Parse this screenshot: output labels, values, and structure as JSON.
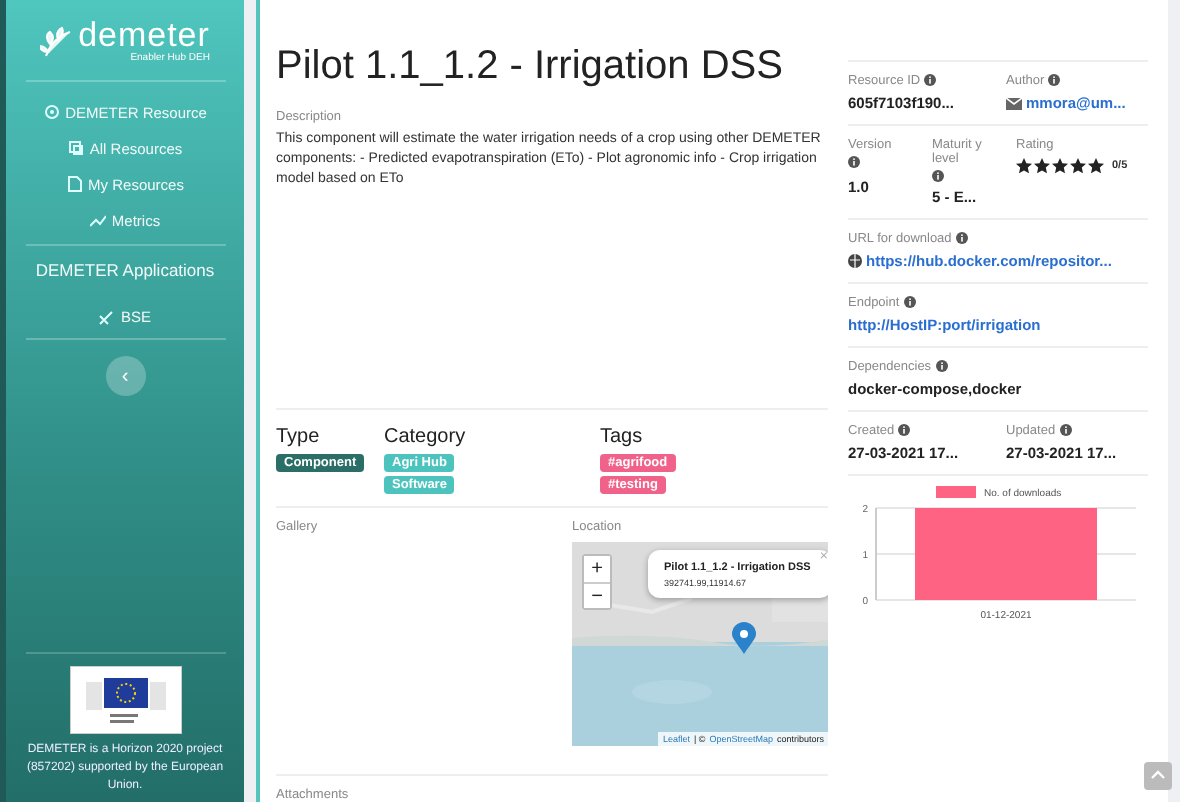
{
  "sidebar": {
    "logo": {
      "name": "demeter",
      "subtitle": "Enabler Hub DEH"
    },
    "items": [
      {
        "label": "DEMETER Resource",
        "kind": "header"
      },
      {
        "label": "All Resources",
        "kind": "link"
      },
      {
        "label": "My Resources",
        "kind": "link"
      },
      {
        "label": "Metrics",
        "kind": "link"
      },
      {
        "label": "DEMETER Applications",
        "kind": "section"
      },
      {
        "label": "BSE",
        "kind": "link"
      }
    ],
    "collapse": "‹",
    "footer": "DEMETER is a Horizon 2020 project (857202) supported by the European Union."
  },
  "title": "Pilot 1.1_1.2 - Irrigation DSS",
  "description": {
    "label": "Description",
    "text": "This component will estimate the water irrigation needs of a crop using other DEMETER components: - Predicted evapotranspiration (ETo) - Plot agronomic info - Crop irrigation model based on ETo"
  },
  "type": {
    "label": "Type",
    "badges": [
      "Component"
    ]
  },
  "category": {
    "label": "Category",
    "badges": [
      "Agri Hub",
      "Software"
    ]
  },
  "tags": {
    "label": "Tags",
    "badges": [
      "#agrifood",
      "#testing"
    ]
  },
  "gallery": {
    "label": "Gallery"
  },
  "location": {
    "label": "Location",
    "zoom_in": "+",
    "zoom_out": "−",
    "popup_title": "Pilot 1.1_1.2 - Irrigation DSS",
    "popup_coords": "392741.99,11914.67",
    "popup_close": "×",
    "attribution_link1": "Leaflet",
    "attribution_sep": "| ©",
    "attribution_link2": "OpenStreetMap",
    "attribution_tail": "contributors"
  },
  "attachments": {
    "label": "Attachments"
  },
  "details": {
    "resource_id": {
      "label": "Resource ID",
      "value": "605f7103f190..."
    },
    "author": {
      "label": "Author",
      "value": "mmora@um..."
    },
    "version": {
      "label": "Version",
      "value": "1.0"
    },
    "maturity": {
      "label": "Maturit y level",
      "value": "5 - E..."
    },
    "rating": {
      "label": "Rating",
      "value": "0/5"
    },
    "url": {
      "label": "URL for download",
      "value": "https://hub.docker.com/repositor..."
    },
    "endpoint": {
      "label": "Endpoint",
      "value": "http://HostIP:port/irrigation"
    },
    "dependencies": {
      "label": "Dependencies",
      "value": "docker-compose,docker"
    },
    "created": {
      "label": "Created",
      "value": "27-03-2021 17..."
    },
    "updated": {
      "label": "Updated",
      "value": "27-03-2021 17..."
    }
  },
  "chart_data": {
    "type": "bar",
    "categories": [
      "01-12-2021"
    ],
    "series": [
      {
        "name": "No. of downloads",
        "color": "#ff6384",
        "values": [
          2
        ]
      }
    ],
    "ylim": [
      0,
      2
    ],
    "yticks": [
      0,
      1,
      2
    ]
  }
}
